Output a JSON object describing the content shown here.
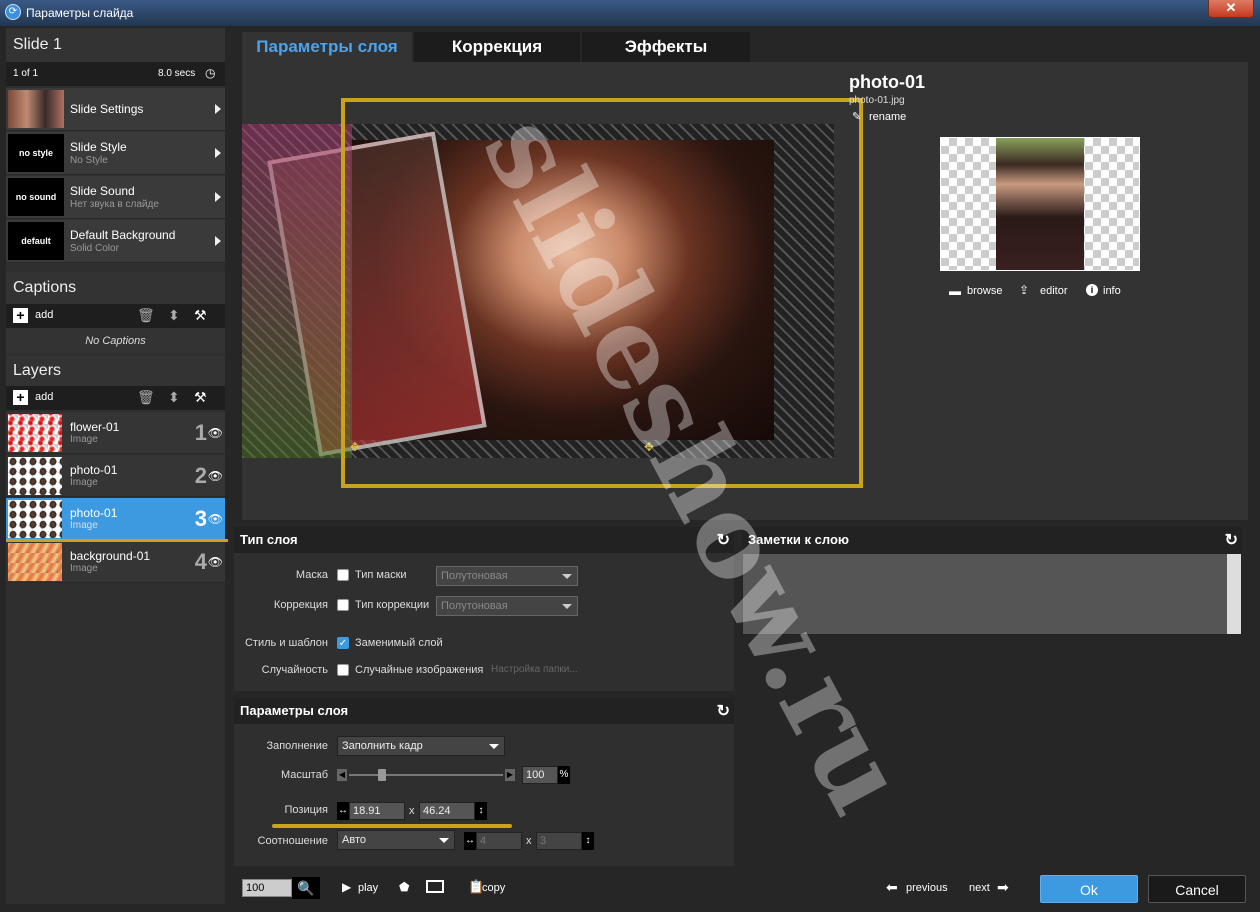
{
  "window": {
    "title": "Параметры слайда"
  },
  "sidebar": {
    "slide_title": "Slide 1",
    "counter": "1 of 1",
    "duration": "8.0 secs",
    "items": [
      {
        "title": "Slide Settings",
        "sub": "",
        "thumb": ""
      },
      {
        "title": "Slide Style",
        "sub": "No Style",
        "thumb": "no style"
      },
      {
        "title": "Slide Sound",
        "sub": "Нет звука в слайде",
        "thumb": "no sound"
      },
      {
        "title": "Default Background",
        "sub": "Solid Color",
        "thumb": "default"
      }
    ],
    "captions_title": "Captions",
    "captions_add": "add",
    "no_captions": "No Captions",
    "layers_title": "Layers",
    "layers_add": "add",
    "layers": [
      {
        "name": "flower-01",
        "type": "Image",
        "num": "1"
      },
      {
        "name": "photo-01",
        "type": "Image",
        "num": "2"
      },
      {
        "name": "photo-01",
        "type": "Image",
        "num": "3"
      },
      {
        "name": "background-01",
        "type": "Image",
        "num": "4"
      }
    ]
  },
  "tabs": [
    {
      "label": "Параметры слоя"
    },
    {
      "label": "Коррекция"
    },
    {
      "label": "Эффекты"
    }
  ],
  "layer_info": {
    "name": "photo-01",
    "file": "photo-01.jpg",
    "rename": "rename",
    "browse": "browse",
    "editor": "editor",
    "info": "info"
  },
  "watermark": "slideshow.ru",
  "layer_type": {
    "title": "Тип слоя",
    "mask_label": "Маска",
    "mask_check": "Тип маски",
    "mask_select": "Полутоновая",
    "corr_label": "Коррекция",
    "corr_check": "Тип коррекции",
    "corr_select": "Полутоновая",
    "style_label": "Стиль и шаблон",
    "style_check": "Заменимый слой",
    "random_label": "Случайность",
    "random_check": "Случайные изображения",
    "random_folder": "Настройка папки..."
  },
  "layer_params": {
    "title": "Параметры слоя",
    "fill_label": "Заполнение",
    "fill_value": "Заполнить кадр",
    "scale_label": "Масштаб",
    "scale_value": "100",
    "scale_unit": "%",
    "scale_level": 100,
    "pos_label": "Позиция",
    "pos_x": "18.91",
    "pos_y": "46.24",
    "x_sep": "x",
    "ratio_label": "Соотношение",
    "ratio_value": "Авто",
    "ratio_w": "4",
    "ratio_h": "3"
  },
  "notes": {
    "title": "Заметки к слою"
  },
  "bottom": {
    "zoom": "100",
    "play": "play",
    "copy": "copy",
    "previous": "previous",
    "next": "next",
    "ok": "Ok",
    "cancel": "Cancel"
  },
  "colors": {
    "accent": "#3d9ae0",
    "highlight": "#c9a41a"
  }
}
